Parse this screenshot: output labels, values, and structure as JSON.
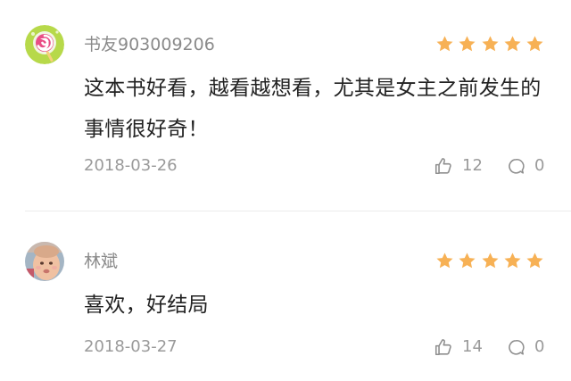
{
  "colors": {
    "star": "#F7B155",
    "username": "#8A8A8A",
    "content": "#222222",
    "meta": "#9A9A9A",
    "divider": "#ECECEC"
  },
  "comments": [
    {
      "username": "书友903009206",
      "avatar": "lollipop-avatar",
      "rating": 5,
      "content": "这本书好看，越看越想看，尤其是女主之前发生的事情很好奇！",
      "date": "2018-03-26",
      "likes": "12",
      "replies": "0"
    },
    {
      "username": "林斌",
      "avatar": "baby-photo-avatar",
      "rating": 5,
      "content": "喜欢，好结局",
      "date": "2018-03-27",
      "likes": "14",
      "replies": "0"
    }
  ]
}
